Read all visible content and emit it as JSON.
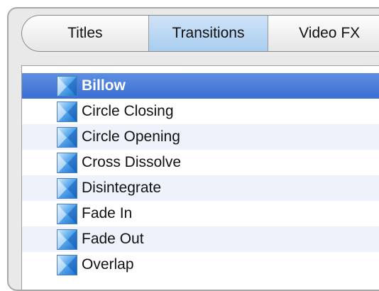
{
  "tabs": [
    {
      "label": "Titles",
      "selected": false
    },
    {
      "label": "Transitions",
      "selected": true
    },
    {
      "label": "Video FX",
      "selected": false
    }
  ],
  "transitions": [
    {
      "label": "Billow",
      "selected": true,
      "icon": "transition-icon"
    },
    {
      "label": "Circle Closing",
      "selected": false,
      "icon": "transition-icon"
    },
    {
      "label": "Circle Opening",
      "selected": false,
      "icon": "transition-icon"
    },
    {
      "label": "Cross Dissolve",
      "selected": false,
      "icon": "transition-icon"
    },
    {
      "label": "Disintegrate",
      "selected": false,
      "icon": "transition-icon"
    },
    {
      "label": "Fade In",
      "selected": false,
      "icon": "transition-icon"
    },
    {
      "label": "Fade Out",
      "selected": false,
      "icon": "transition-icon"
    },
    {
      "label": "Overlap",
      "selected": false,
      "icon": "transition-icon"
    }
  ],
  "colors": {
    "selection": "#3a6fd4",
    "selected_tab": "#a9cdf0",
    "alternate_row": "#eef3fb"
  }
}
